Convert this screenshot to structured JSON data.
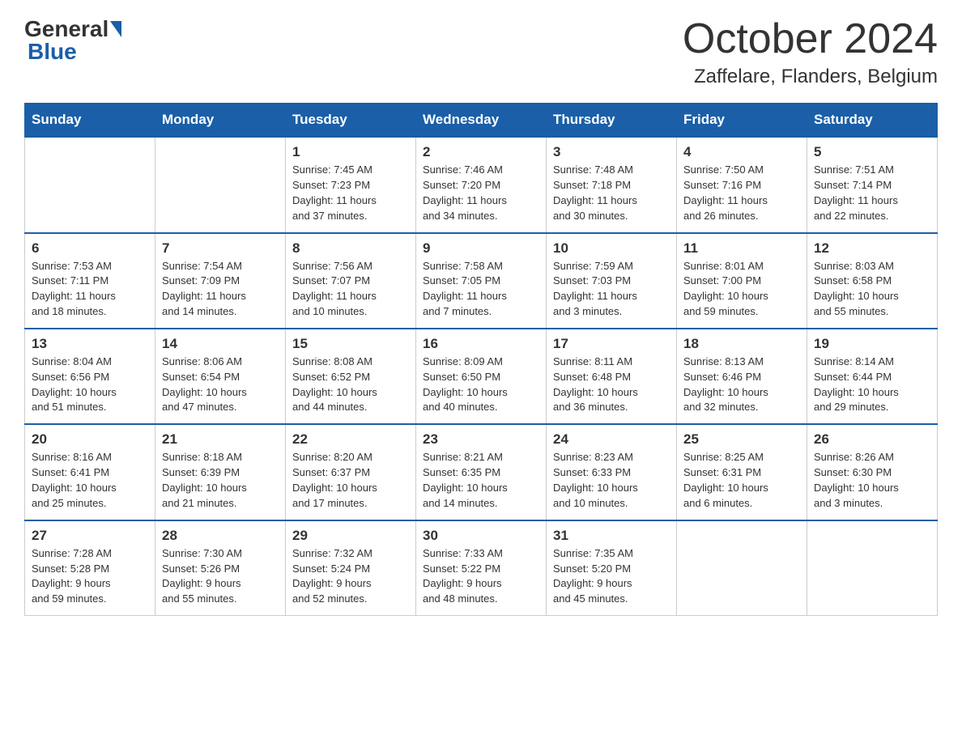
{
  "header": {
    "logo_general": "General",
    "logo_blue": "Blue",
    "month": "October 2024",
    "location": "Zaffelare, Flanders, Belgium"
  },
  "days_of_week": [
    "Sunday",
    "Monday",
    "Tuesday",
    "Wednesday",
    "Thursday",
    "Friday",
    "Saturday"
  ],
  "weeks": [
    [
      {
        "day": "",
        "info": ""
      },
      {
        "day": "",
        "info": ""
      },
      {
        "day": "1",
        "info": "Sunrise: 7:45 AM\nSunset: 7:23 PM\nDaylight: 11 hours\nand 37 minutes."
      },
      {
        "day": "2",
        "info": "Sunrise: 7:46 AM\nSunset: 7:20 PM\nDaylight: 11 hours\nand 34 minutes."
      },
      {
        "day": "3",
        "info": "Sunrise: 7:48 AM\nSunset: 7:18 PM\nDaylight: 11 hours\nand 30 minutes."
      },
      {
        "day": "4",
        "info": "Sunrise: 7:50 AM\nSunset: 7:16 PM\nDaylight: 11 hours\nand 26 minutes."
      },
      {
        "day": "5",
        "info": "Sunrise: 7:51 AM\nSunset: 7:14 PM\nDaylight: 11 hours\nand 22 minutes."
      }
    ],
    [
      {
        "day": "6",
        "info": "Sunrise: 7:53 AM\nSunset: 7:11 PM\nDaylight: 11 hours\nand 18 minutes."
      },
      {
        "day": "7",
        "info": "Sunrise: 7:54 AM\nSunset: 7:09 PM\nDaylight: 11 hours\nand 14 minutes."
      },
      {
        "day": "8",
        "info": "Sunrise: 7:56 AM\nSunset: 7:07 PM\nDaylight: 11 hours\nand 10 minutes."
      },
      {
        "day": "9",
        "info": "Sunrise: 7:58 AM\nSunset: 7:05 PM\nDaylight: 11 hours\nand 7 minutes."
      },
      {
        "day": "10",
        "info": "Sunrise: 7:59 AM\nSunset: 7:03 PM\nDaylight: 11 hours\nand 3 minutes."
      },
      {
        "day": "11",
        "info": "Sunrise: 8:01 AM\nSunset: 7:00 PM\nDaylight: 10 hours\nand 59 minutes."
      },
      {
        "day": "12",
        "info": "Sunrise: 8:03 AM\nSunset: 6:58 PM\nDaylight: 10 hours\nand 55 minutes."
      }
    ],
    [
      {
        "day": "13",
        "info": "Sunrise: 8:04 AM\nSunset: 6:56 PM\nDaylight: 10 hours\nand 51 minutes."
      },
      {
        "day": "14",
        "info": "Sunrise: 8:06 AM\nSunset: 6:54 PM\nDaylight: 10 hours\nand 47 minutes."
      },
      {
        "day": "15",
        "info": "Sunrise: 8:08 AM\nSunset: 6:52 PM\nDaylight: 10 hours\nand 44 minutes."
      },
      {
        "day": "16",
        "info": "Sunrise: 8:09 AM\nSunset: 6:50 PM\nDaylight: 10 hours\nand 40 minutes."
      },
      {
        "day": "17",
        "info": "Sunrise: 8:11 AM\nSunset: 6:48 PM\nDaylight: 10 hours\nand 36 minutes."
      },
      {
        "day": "18",
        "info": "Sunrise: 8:13 AM\nSunset: 6:46 PM\nDaylight: 10 hours\nand 32 minutes."
      },
      {
        "day": "19",
        "info": "Sunrise: 8:14 AM\nSunset: 6:44 PM\nDaylight: 10 hours\nand 29 minutes."
      }
    ],
    [
      {
        "day": "20",
        "info": "Sunrise: 8:16 AM\nSunset: 6:41 PM\nDaylight: 10 hours\nand 25 minutes."
      },
      {
        "day": "21",
        "info": "Sunrise: 8:18 AM\nSunset: 6:39 PM\nDaylight: 10 hours\nand 21 minutes."
      },
      {
        "day": "22",
        "info": "Sunrise: 8:20 AM\nSunset: 6:37 PM\nDaylight: 10 hours\nand 17 minutes."
      },
      {
        "day": "23",
        "info": "Sunrise: 8:21 AM\nSunset: 6:35 PM\nDaylight: 10 hours\nand 14 minutes."
      },
      {
        "day": "24",
        "info": "Sunrise: 8:23 AM\nSunset: 6:33 PM\nDaylight: 10 hours\nand 10 minutes."
      },
      {
        "day": "25",
        "info": "Sunrise: 8:25 AM\nSunset: 6:31 PM\nDaylight: 10 hours\nand 6 minutes."
      },
      {
        "day": "26",
        "info": "Sunrise: 8:26 AM\nSunset: 6:30 PM\nDaylight: 10 hours\nand 3 minutes."
      }
    ],
    [
      {
        "day": "27",
        "info": "Sunrise: 7:28 AM\nSunset: 5:28 PM\nDaylight: 9 hours\nand 59 minutes."
      },
      {
        "day": "28",
        "info": "Sunrise: 7:30 AM\nSunset: 5:26 PM\nDaylight: 9 hours\nand 55 minutes."
      },
      {
        "day": "29",
        "info": "Sunrise: 7:32 AM\nSunset: 5:24 PM\nDaylight: 9 hours\nand 52 minutes."
      },
      {
        "day": "30",
        "info": "Sunrise: 7:33 AM\nSunset: 5:22 PM\nDaylight: 9 hours\nand 48 minutes."
      },
      {
        "day": "31",
        "info": "Sunrise: 7:35 AM\nSunset: 5:20 PM\nDaylight: 9 hours\nand 45 minutes."
      },
      {
        "day": "",
        "info": ""
      },
      {
        "day": "",
        "info": ""
      }
    ]
  ]
}
